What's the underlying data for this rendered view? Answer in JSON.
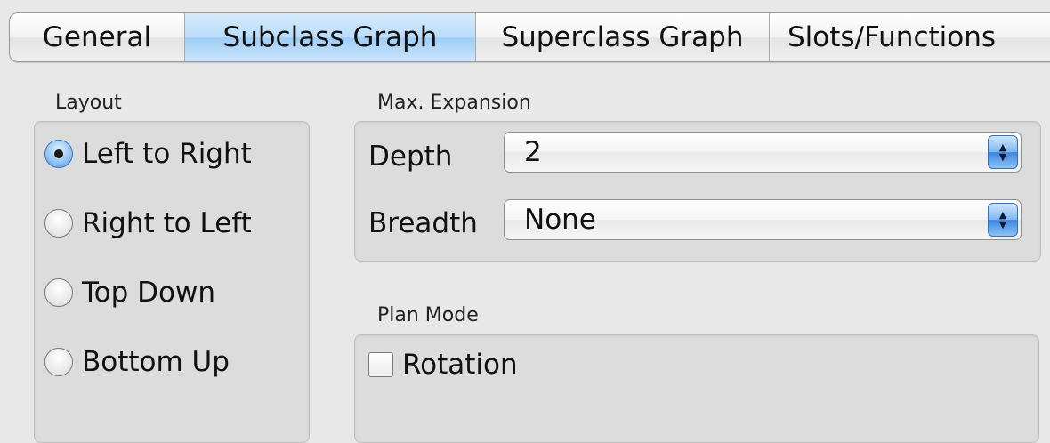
{
  "tabs": [
    {
      "label": "General"
    },
    {
      "label": "Subclass Graph"
    },
    {
      "label": "Superclass Graph"
    },
    {
      "label": "Slots/Functions"
    }
  ],
  "active_tab": "Subclass Graph",
  "layout": {
    "title": "Layout",
    "options": [
      "Left to Right",
      "Right to Left",
      "Top Down",
      "Bottom Up"
    ],
    "selected": "Left to Right"
  },
  "max_expansion": {
    "title": "Max. Expansion",
    "depth_label": "Depth",
    "depth_value": "2",
    "breadth_label": "Breadth",
    "breadth_value": "None"
  },
  "plan_mode": {
    "title": "Plan Mode",
    "rotation_label": "Rotation",
    "rotation_checked": false
  },
  "colors": {
    "active_tab": "#b9dcfb",
    "stepper": "#4a8fe0",
    "panel": "#dcdcdc"
  }
}
